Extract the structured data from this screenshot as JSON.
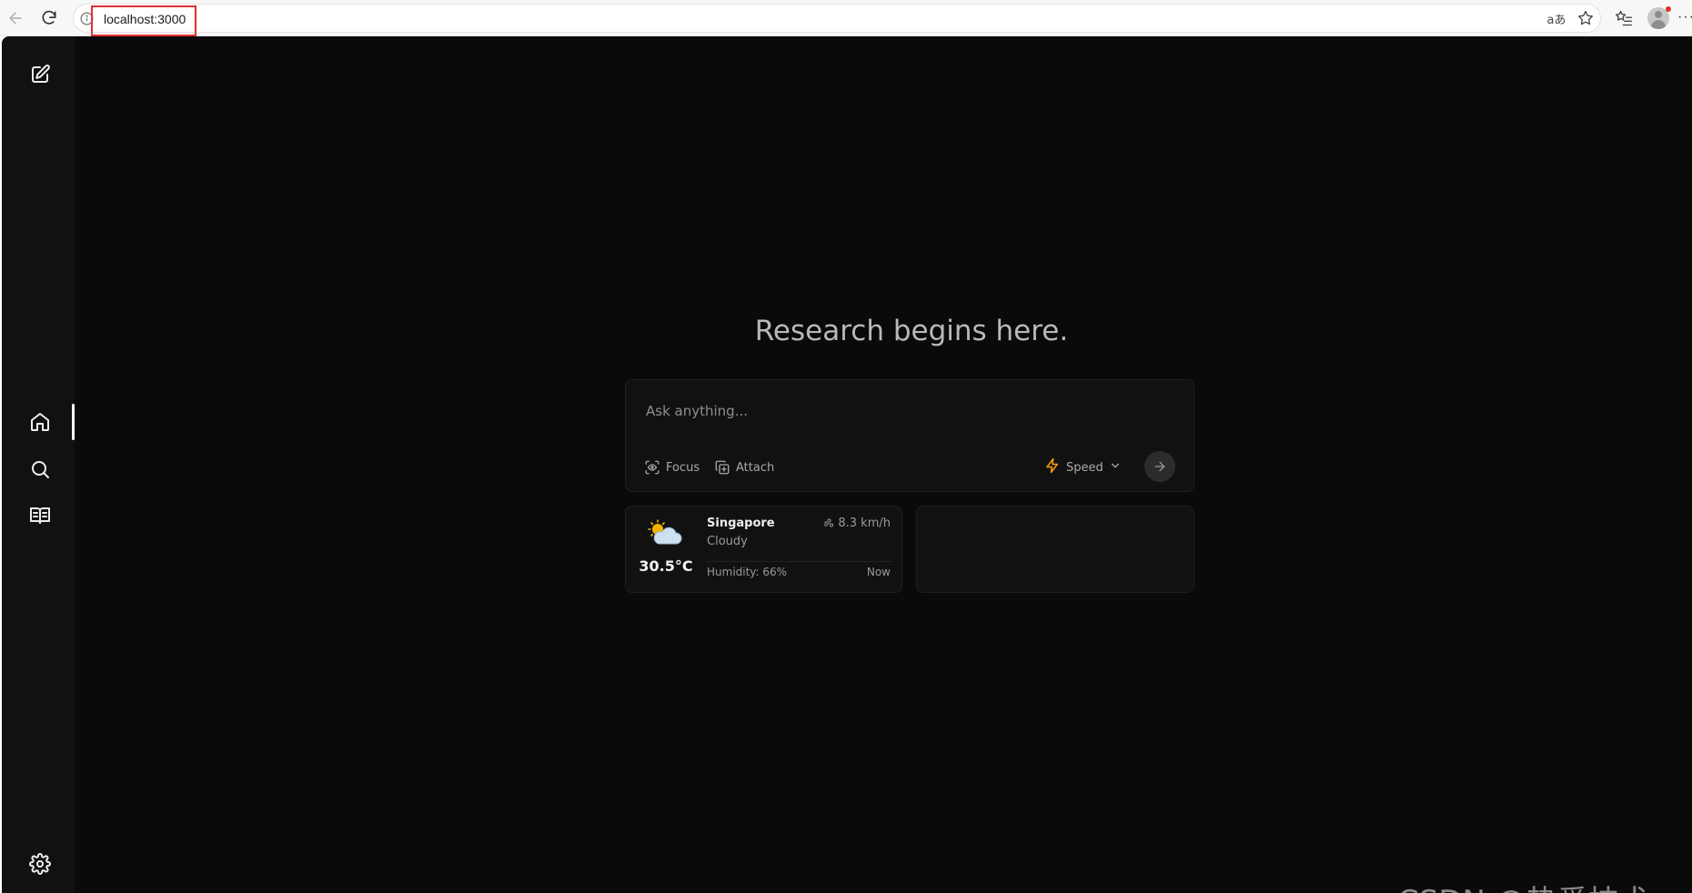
{
  "browser": {
    "address": "localhost:3000",
    "translate_label": "aあ",
    "icons": [
      "back-icon",
      "reload-icon",
      "site-info-icon",
      "translate-icon",
      "favorite-star-icon",
      "favorites-list-icon",
      "profile-icon",
      "more-icon"
    ]
  },
  "sidebar": {
    "items": [
      {
        "name": "new-chat",
        "icon": "edit-icon"
      },
      {
        "name": "home",
        "icon": "home-icon",
        "active": true
      },
      {
        "name": "discover",
        "icon": "search-icon"
      },
      {
        "name": "library",
        "icon": "book-icon"
      },
      {
        "name": "settings",
        "icon": "gear-icon"
      }
    ]
  },
  "main": {
    "title": "Research begins here.",
    "search": {
      "placeholder": "Ask anything...",
      "focus_label": "Focus",
      "attach_label": "Attach",
      "speed_label": "Speed"
    },
    "weather": {
      "city": "Singapore",
      "condition": "Cloudy",
      "temperature": "30.5°C",
      "wind": "8.3 km/h",
      "humidity": "Humidity: 66%",
      "time": "Now"
    }
  },
  "watermark": "CSDN @热爱技术。",
  "colors": {
    "background": "#0a0a0a",
    "sidebar": "#111111",
    "card": "#111111",
    "accent_speed": "#f59e0b",
    "address_highlight": "#e03030"
  }
}
